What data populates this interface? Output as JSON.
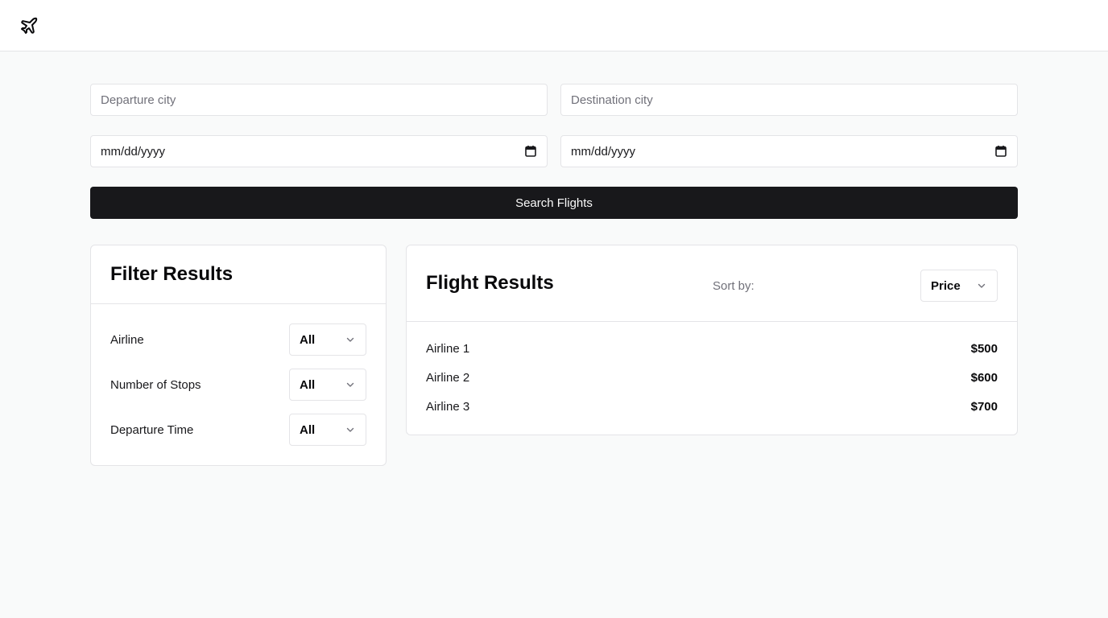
{
  "header": {
    "logo_icon": "plane-icon"
  },
  "search": {
    "departure_placeholder": "Departure city",
    "destination_placeholder": "Destination city",
    "departure_date": "mm/dd/yyyy",
    "return_date": "mm/dd/yyyy",
    "date_icon": "calendar-icon",
    "button_label": "Search Flights"
  },
  "filters": {
    "title": "Filter Results",
    "items": [
      {
        "label": "Airline",
        "value": "All"
      },
      {
        "label": "Number of Stops",
        "value": "All"
      },
      {
        "label": "Departure Time",
        "value": "All"
      }
    ]
  },
  "results": {
    "title": "Flight Results",
    "sort_label": "Sort by:",
    "sort_value": "Price",
    "items": [
      {
        "airline": "Airline 1",
        "price": "$500"
      },
      {
        "airline": "Airline 2",
        "price": "$600"
      },
      {
        "airline": "Airline 3",
        "price": "$700"
      }
    ]
  },
  "colors": {
    "primary": "#18181b",
    "background": "#f9fafa",
    "border": "#e4e4e7",
    "muted_text": "#71717a"
  }
}
